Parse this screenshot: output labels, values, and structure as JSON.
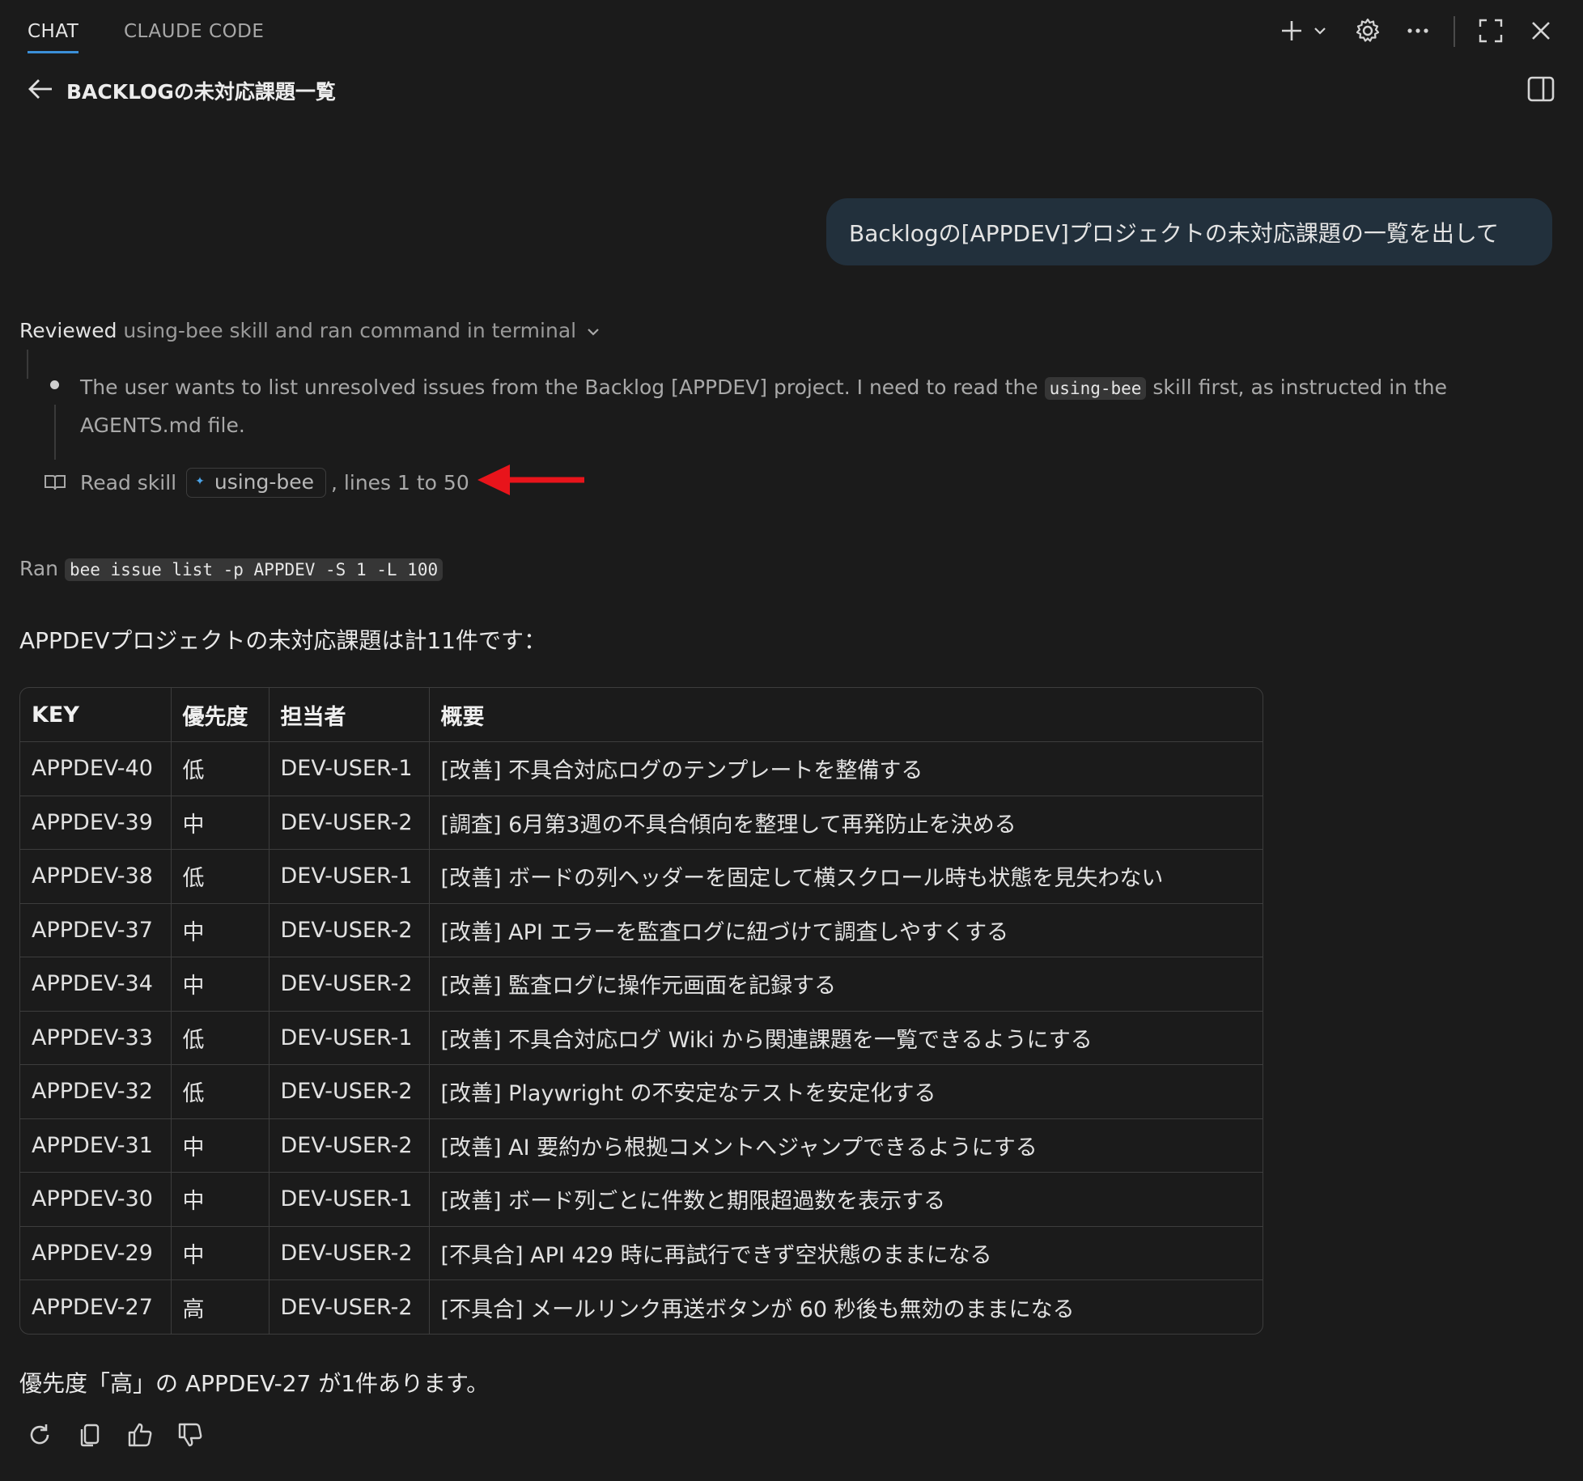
{
  "tabs": [
    {
      "label": "CHAT",
      "active": true
    },
    {
      "label": "CLAUDE CODE",
      "active": false
    }
  ],
  "toolbar_icons": [
    "plus-icon",
    "chevron-down-icon",
    "gear-icon",
    "more-icon",
    "fullscreen-icon",
    "close-icon"
  ],
  "conversation": {
    "title": "BACKLOGの未対応課題一覧"
  },
  "user_message": "Backlogの[APPDEV]プロジェクトの未対応課題の一覧を出して",
  "activity": {
    "reviewed_label": "Reviewed",
    "reviewed_rest": "using-bee skill and ran command in terminal",
    "thought_before": "The user wants to list unresolved issues from the Backlog [APPDEV] project. I need to read the",
    "thought_code": "using-bee",
    "thought_after": "skill first, as instructed in the AGENTS.md file.",
    "read_prefix": "Read skill",
    "skill_name": "using-bee",
    "read_suffix": ", lines 1 to 50",
    "annotation_color": "#e8141b"
  },
  "ran": {
    "label": "Ran",
    "command": "bee issue list -p APPDEV -S 1 -L 100"
  },
  "answer": {
    "heading": "APPDEVプロジェクトの未対応課題は計11件です：",
    "columns": [
      "KEY",
      "優先度",
      "担当者",
      "概要"
    ],
    "rows": [
      [
        "APPDEV-40",
        "低",
        "DEV-USER-1",
        "[改善] 不具合対応ログのテンプレートを整備する"
      ],
      [
        "APPDEV-39",
        "中",
        "DEV-USER-2",
        "[調査] 6月第3週の不具合傾向を整理して再発防止を決める"
      ],
      [
        "APPDEV-38",
        "低",
        "DEV-USER-1",
        "[改善] ボードの列ヘッダーを固定して横スクロール時も状態を見失わない"
      ],
      [
        "APPDEV-37",
        "中",
        "DEV-USER-2",
        "[改善] API エラーを監査ログに紐づけて調査しやすくする"
      ],
      [
        "APPDEV-34",
        "中",
        "DEV-USER-2",
        "[改善] 監査ログに操作元画面を記録する"
      ],
      [
        "APPDEV-33",
        "低",
        "DEV-USER-1",
        "[改善] 不具合対応ログ Wiki から関連課題を一覧できるようにする"
      ],
      [
        "APPDEV-32",
        "低",
        "DEV-USER-2",
        "[改善] Playwright の不安定なテストを安定化する"
      ],
      [
        "APPDEV-31",
        "中",
        "DEV-USER-2",
        "[改善] AI 要約から根拠コメントへジャンプできるようにする"
      ],
      [
        "APPDEV-30",
        "中",
        "DEV-USER-1",
        "[改善] ボード列ごとに件数と期限超過数を表示する"
      ],
      [
        "APPDEV-29",
        "中",
        "DEV-USER-2",
        "[不具合] API 429 時に再試行できず空状態のままになる"
      ],
      [
        "APPDEV-27",
        "高",
        "DEV-USER-2",
        "[不具合] メールリンク再送ボタンが 60 秒後も無効のままになる"
      ]
    ],
    "footer": "優先度「高」の APPDEV-27 が1件あります。"
  },
  "message_actions": [
    "retry-icon",
    "copy-icon",
    "thumbs-up-icon",
    "thumbs-down-icon"
  ]
}
